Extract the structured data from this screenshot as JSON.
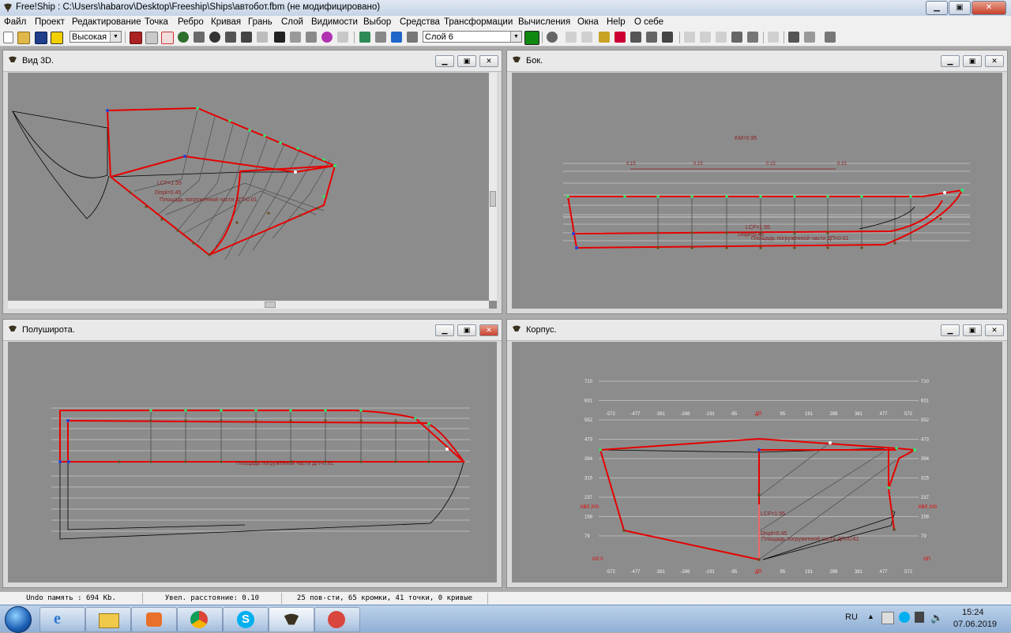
{
  "window": {
    "title": "Free!Ship  : C:\\Users\\habarov\\Desktop\\Freeship\\Ships\\автобот.fbm (не модифицировано)"
  },
  "menu": [
    "Файл",
    "Проект",
    "Редактирование",
    "Точка",
    "Ребро",
    "Кривая",
    "Грань",
    "Слой",
    "Видимости",
    "Выбор",
    "Средства",
    "Трансформации",
    "Вычисления",
    "Окна",
    "Help",
    "О себе"
  ],
  "toolbar": {
    "precision_select": "Высокая",
    "layer_select": "Слой 6",
    "layer_color": "#118811"
  },
  "views": {
    "view3d": {
      "title": "Вид 3D.",
      "labels": {
        "lcf": "LCF=1.55",
        "displ": "Displ=0.45",
        "area": "Площадь погруженной части ДП=0.61"
      }
    },
    "side": {
      "title": "Бок.",
      "labels": {
        "km": "KM=0.95",
        "lcf": "LCF=1.55",
        "displ": "Displ=0.45",
        "area": "Площадь погруженной части ДП=0.61"
      },
      "offsets": [
        "0.15",
        "0.15",
        "0.15",
        "0.15"
      ]
    },
    "plan": {
      "title": "Полуширота.",
      "labels": {
        "area": "Площадь погруженной части ДП=0.61"
      }
    },
    "body": {
      "title": "Корпус.",
      "labels": {
        "lcf": "LCF=1.55",
        "displ": "Displ=0.45",
        "area": "Площадь погруженной части ДП=0.61",
        "kvl": "КВЛ 200",
        "cl": "ДП",
        "sl": "ОП",
        "bl": "ОЛ 0"
      },
      "y_ticks": [
        "710",
        "631",
        "552",
        "473",
        "394",
        "315",
        "237",
        "158",
        "79"
      ],
      "x_ticks_top": [
        "-572",
        "-477",
        "-381",
        "-286",
        "-191",
        "-95",
        "ДП",
        "95",
        "191",
        "286",
        "381",
        "477",
        "572"
      ],
      "x_ticks_bottom": [
        "-572",
        "-477",
        "-381",
        "-286",
        "-191",
        "-95",
        "ДП",
        "95",
        "191",
        "286",
        "381",
        "477",
        "572"
      ]
    }
  },
  "status": {
    "undo": "Undo память : 694 Kb.",
    "zoom": "Увел. расстояние: 0.10",
    "counts": "25 пов-сти, 65 кромки, 41 точки, 0 кривые"
  },
  "tray": {
    "lang": "RU",
    "time": "15:24",
    "date": "07.06.2019"
  }
}
